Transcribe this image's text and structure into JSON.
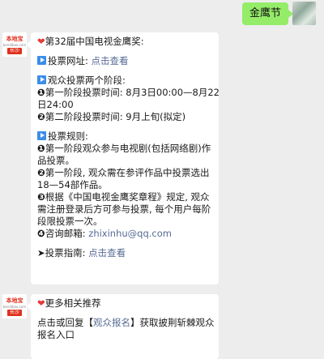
{
  "outgoing": {
    "text": "金鹰节"
  },
  "bot_avatar": {
    "brand": "本地宝",
    "sub": "bendibao.com",
    "city": "长沙"
  },
  "msg1": {
    "l01_icon": "❤",
    "l01": "第32届中国电视金鹰奖:",
    "l02_label": "投票网址: ",
    "l02_link": "点击查看",
    "l03": "观众投票两个阶段:",
    "l04_num": "❶",
    "l04": "第一阶段投票时间: 8月3日00:00—8月22",
    "l05": "日24:00",
    "l06_num": "❷",
    "l06": "第二阶段投票时间: 9月上旬(拟定)",
    "l07": "投票规则:",
    "l08_num": "❶",
    "l08": "第一阶段观众参与电视剧(包括网络剧)作",
    "l09": "品投票。",
    "l10_num": "❷",
    "l10": "第一阶段, 观众需在参评作品中投票选出",
    "l11": "18—54部作品。",
    "l12_num": "❸",
    "l12": "根据《中国电视金鹰奖章程》规定, 观众",
    "l13": "需注册登录后方可参与投票, 每个用户每阶",
    "l14": "段限投票一次。",
    "l15_num": "❹",
    "l15_label": "咨询邮箱: ",
    "l15_link": "zhixinhu@qq.com",
    "l16_icon": "➤",
    "l16_label": "投票指南: ",
    "l16_link": "点击查看"
  },
  "msg2": {
    "l1_icon": "❤",
    "l1": "更多相关推荐",
    "l2_a": "点击或回复【",
    "l2_link": "观众报名",
    "l2_b": "】获取披荆斩棘观众",
    "l3": "报名入口"
  },
  "colors": {
    "outgoing_bubble": "#95ec69",
    "link": "#576b95",
    "background": "#ededed"
  }
}
